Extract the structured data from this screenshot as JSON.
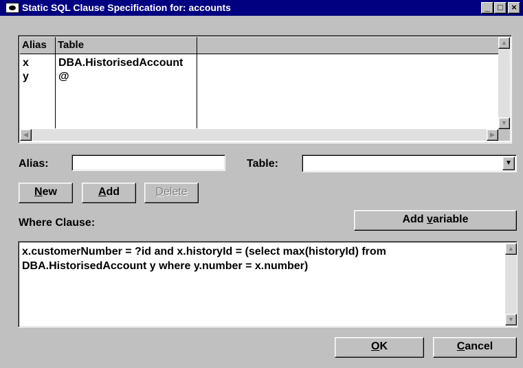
{
  "window": {
    "title": "Static SQL Clause Specification for: accounts",
    "minimize_glyph": "_",
    "maximize_glyph": "□",
    "close_glyph": "×"
  },
  "grid": {
    "headers": [
      "Alias",
      "Table"
    ],
    "rows": [
      {
        "alias": "x",
        "table": "DBA.HistorisedAccount"
      },
      {
        "alias": "y",
        "table": "@"
      }
    ]
  },
  "form": {
    "alias_label": "Alias:",
    "alias_value": "",
    "table_label": "Table:",
    "table_value": ""
  },
  "buttons": {
    "new_label": "New",
    "new_mnemonic": "N",
    "add_label": "Add",
    "add_mnemonic": "A",
    "delete_label": "Delete",
    "delete_mnemonic": "D",
    "add_variable_label": "Add variable",
    "ok_label": "OK",
    "cancel_label": "Cancel"
  },
  "where": {
    "label": "Where Clause:",
    "text": "x.customerNumber = ?id and x.historyId = (select max(historyId) from\nDBA.HistorisedAccount y where y.number = x.number)"
  },
  "icons": {
    "app": "eye-icon",
    "scroll_up": "arrow-up-icon",
    "scroll_down": "arrow-down-icon",
    "scroll_left": "arrow-left-icon",
    "scroll_right": "arrow-right-icon",
    "dropdown": "chevron-down-icon"
  },
  "colors": {
    "titlebar": "#000080",
    "face": "#c0c0c0"
  }
}
